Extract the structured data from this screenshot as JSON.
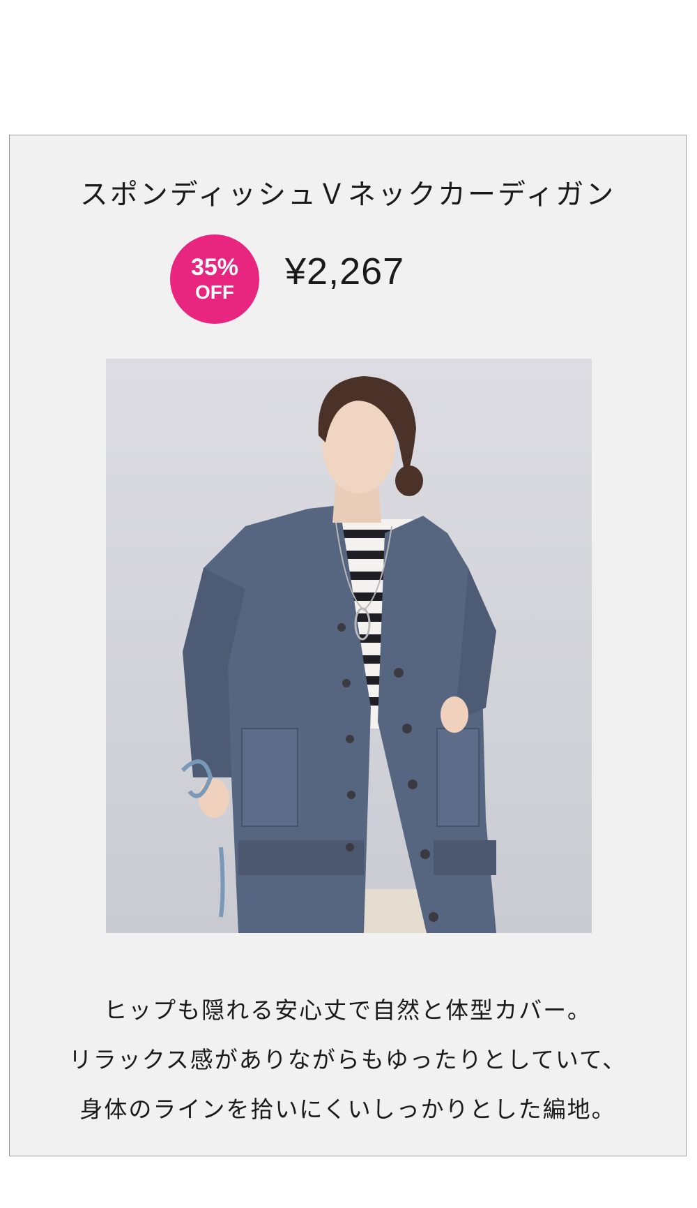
{
  "product": {
    "title": "スポンディッシュＶネックカーディガン",
    "badge": {
      "percent": "35%",
      "off": "OFF",
      "color": "#e8257f"
    },
    "price": "¥2,267",
    "image": {
      "icon": "product-photo-model-cardigan"
    },
    "description": [
      "ヒップも隠れる安心丈で自然と体型カバー。",
      "リラックス感がありながらもゆったりとしていて、",
      "身体のラインを拾いにくいしっかりとした編地。"
    ]
  }
}
